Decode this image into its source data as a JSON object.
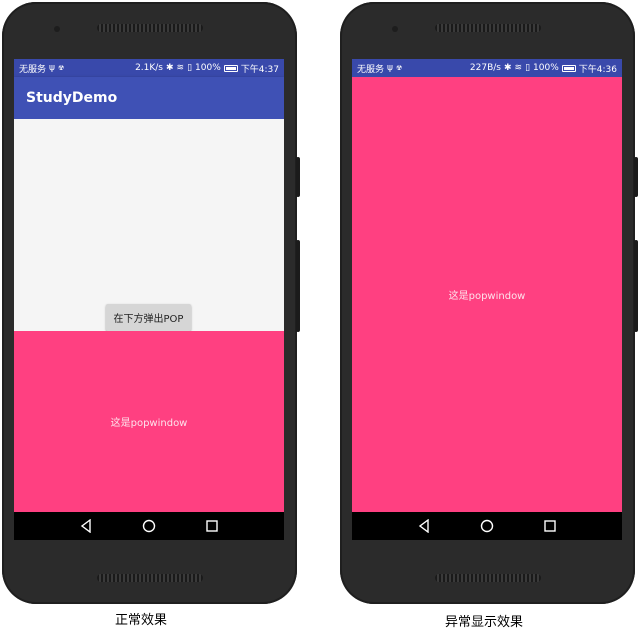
{
  "phones": [
    {
      "status_bar": {
        "carrier": "无服务",
        "net_speed": "2.1K/s",
        "battery": "100%",
        "time": "下午4:37"
      },
      "app_bar": {
        "title": "StudyDemo"
      },
      "button": {
        "label": "在下方弹出POP"
      },
      "popup": {
        "text": "这是popwindow"
      },
      "caption": "正常效果"
    },
    {
      "status_bar": {
        "carrier": "无服务",
        "net_speed": "227B/s",
        "battery": "100%",
        "time": "下午4:36"
      },
      "popup": {
        "text": "这是popwindow"
      },
      "caption": "异常显示效果"
    }
  ],
  "colors": {
    "status_bar": "#3949ab",
    "app_bar": "#3f51b5",
    "popup": "#ff4081",
    "content_bg": "#f5f5f5",
    "phone_body": "#2b2b2b"
  }
}
